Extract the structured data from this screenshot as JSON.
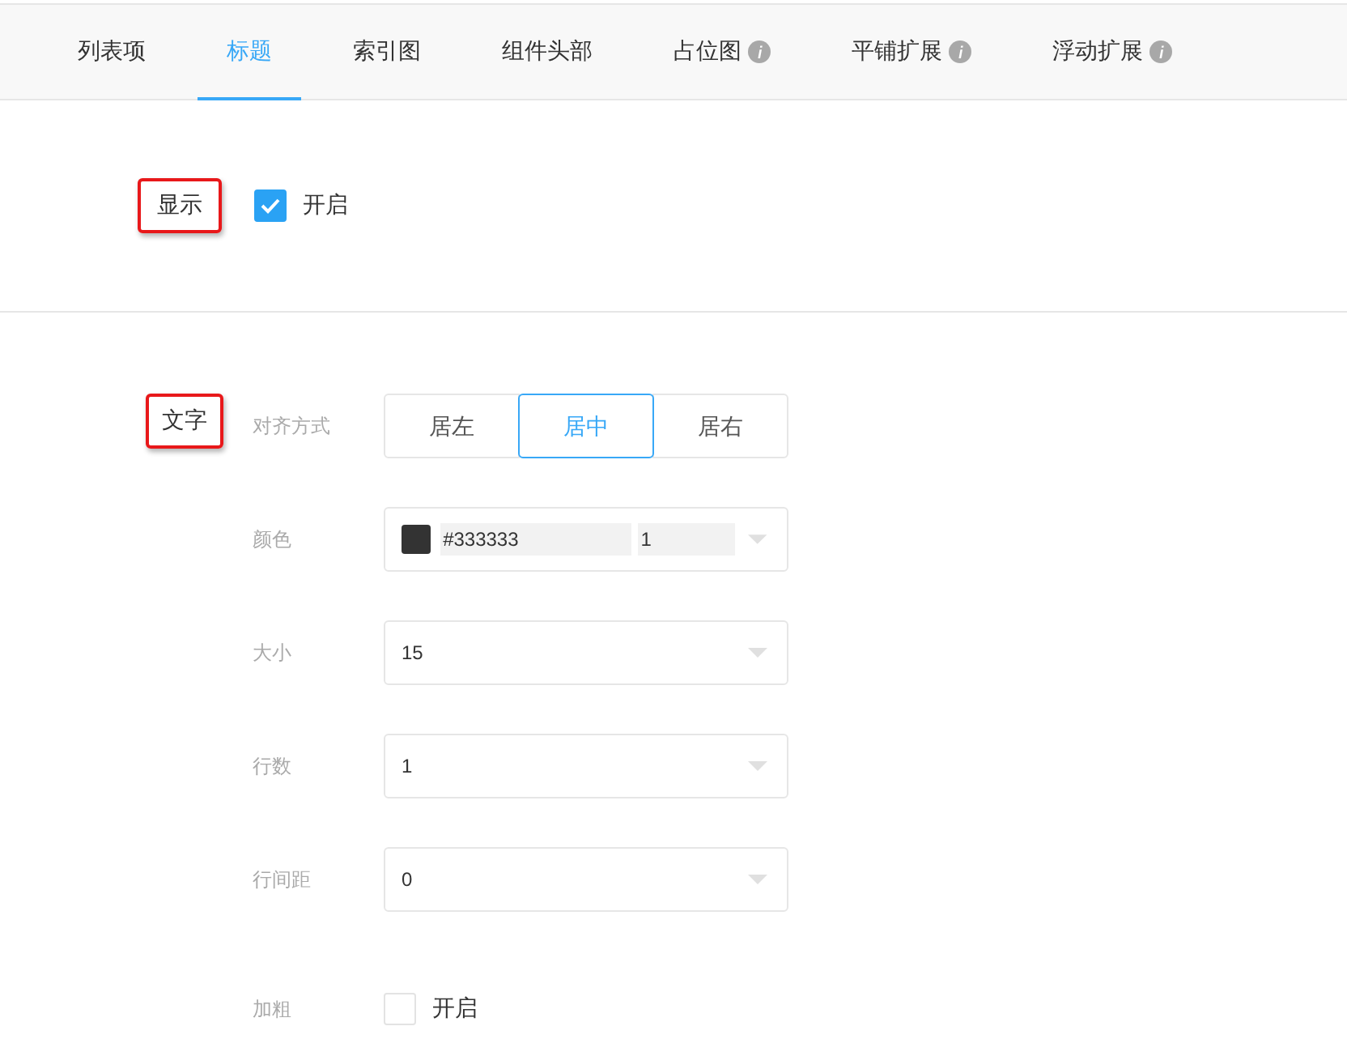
{
  "tabs": [
    {
      "label": "列表项",
      "selected": false,
      "info": false
    },
    {
      "label": "标题",
      "selected": true,
      "info": false
    },
    {
      "label": "索引图",
      "selected": false,
      "info": false
    },
    {
      "label": "组件头部",
      "selected": false,
      "info": false
    },
    {
      "label": "占位图",
      "selected": false,
      "info": true
    },
    {
      "label": "平铺扩展",
      "selected": false,
      "info": true
    },
    {
      "label": "浮动扩展",
      "selected": false,
      "info": true
    }
  ],
  "display_section": {
    "label": "显示",
    "highlighted": true,
    "toggle": {
      "label": "开启",
      "checked": true
    }
  },
  "text_section": {
    "label": "文字",
    "highlighted": true,
    "fields": [
      {
        "kind": "segmented",
        "label": "对齐方式",
        "options": [
          {
            "label": "居左",
            "selected": false
          },
          {
            "label": "居中",
            "selected": true
          },
          {
            "label": "居右",
            "selected": false
          }
        ]
      },
      {
        "kind": "color",
        "label": "颜色",
        "color": "#333333",
        "value": "#333333",
        "opacity": "1"
      },
      {
        "kind": "select",
        "label": "大小",
        "value": "15"
      },
      {
        "kind": "select",
        "label": "行数",
        "value": "1"
      },
      {
        "kind": "select",
        "label": "行间距",
        "value": "0"
      },
      {
        "kind": "checkbox",
        "label": "加粗",
        "option": "开启",
        "checked": false
      }
    ]
  }
}
